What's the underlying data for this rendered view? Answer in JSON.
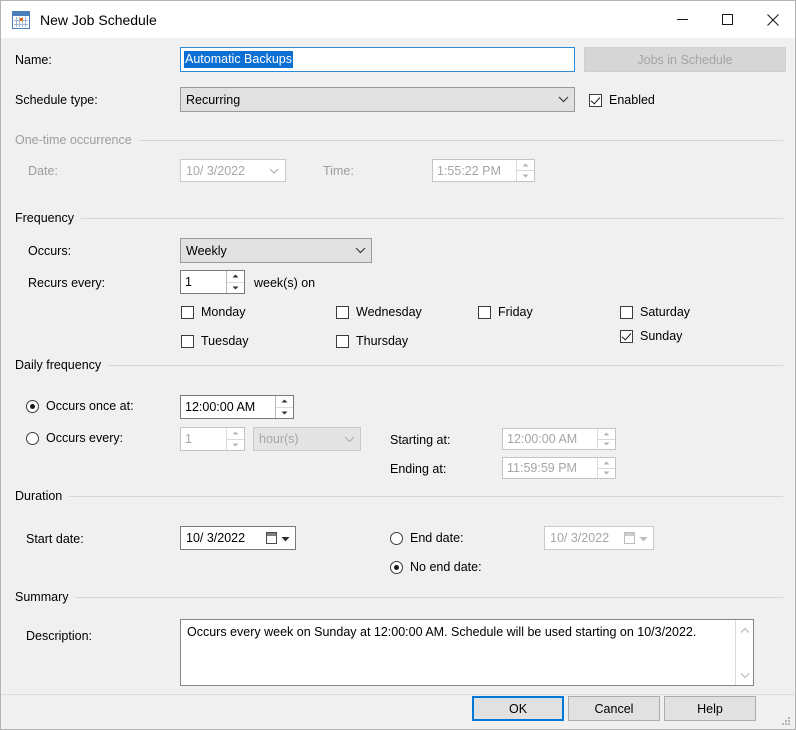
{
  "window": {
    "title": "New Job Schedule",
    "icon": "calendar-icon",
    "minimize_label": "Minimize",
    "maximize_label": "Maximize",
    "close_label": "Close"
  },
  "header": {
    "name_label": "Name:",
    "name_value": "Automatic Backups",
    "jobs_in_schedule_label": "Jobs in Schedule",
    "schedule_type_label": "Schedule type:",
    "schedule_type_value": "Recurring",
    "enabled_label": "Enabled",
    "enabled_checked": true
  },
  "one_time": {
    "group_label": "One-time occurrence",
    "date_label": "Date:",
    "date_value": "10/ 3/2022",
    "time_label": "Time:",
    "time_value": "1:55:22 PM",
    "disabled": true
  },
  "frequency": {
    "group_label": "Frequency",
    "occurs_label": "Occurs:",
    "occurs_value": "Weekly",
    "recurs_label": "Recurs every:",
    "recurs_value": "1",
    "recurs_unit": "week(s) on",
    "days": [
      {
        "label": "Monday",
        "checked": false
      },
      {
        "label": "Tuesday",
        "checked": false
      },
      {
        "label": "Wednesday",
        "checked": false
      },
      {
        "label": "Thursday",
        "checked": false
      },
      {
        "label": "Friday",
        "checked": false
      },
      {
        "label": "Saturday",
        "checked": false
      },
      {
        "label": "Sunday",
        "checked": true
      }
    ]
  },
  "daily": {
    "group_label": "Daily frequency",
    "once_label": "Occurs once at:",
    "once_selected": true,
    "once_value": "12:00:00 AM",
    "every_label": "Occurs every:",
    "every_selected": false,
    "every_value": "1",
    "every_unit": "hour(s)",
    "starting_label": "Starting at:",
    "starting_value": "12:00:00 AM",
    "ending_label": "Ending at:",
    "ending_value": "11:59:59 PM"
  },
  "duration": {
    "group_label": "Duration",
    "start_label": "Start date:",
    "start_value": "10/ 3/2022",
    "end_date_label": "End date:",
    "end_date_selected": false,
    "end_date_value": "10/ 3/2022",
    "no_end_label": "No end date:",
    "no_end_selected": true
  },
  "summary": {
    "group_label": "Summary",
    "description_label": "Description:",
    "description_value": "Occurs every week on Sunday at 12:00:00 AM. Schedule will be used starting on 10/3/2022."
  },
  "footer": {
    "ok_label": "OK",
    "cancel_label": "Cancel",
    "help_label": "Help"
  },
  "colors": {
    "accent": "#0078d7",
    "selection": "#0b6fd4",
    "dialog_bg": "#f0f0f0",
    "control_bg": "#e1e1e1",
    "disabled_text": "#9d9d9d"
  }
}
